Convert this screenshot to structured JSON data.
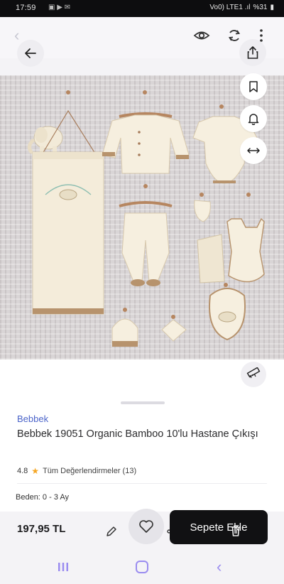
{
  "status_bar": {
    "time": "17:59",
    "signal_text": "Vo0) LTE1 .ıl",
    "battery": "%31"
  },
  "product": {
    "brand": "Bebbek",
    "title": "Bebbek 19051 Organic Bamboo 10'lu Hastane Çıkışı",
    "rating": "4.8",
    "reviews_label": "Tüm Değerlendirmeler (13)",
    "size_label": "Beden: 0 - 3 Ay",
    "price": "197,95 TL"
  },
  "actions": {
    "add_to_cart": "Sepete Ekle"
  },
  "colors": {
    "brand": "#4a63c9",
    "star": "#f5a623",
    "cta_bg": "#111113",
    "nav_accent": "#9a8cf0"
  },
  "icons": [
    "back-arrow-icon",
    "eye-icon",
    "rotate-icon",
    "more-vertical-icon",
    "share-icon",
    "bookmark-icon",
    "bell-icon",
    "compare-icon",
    "ruler-icon",
    "edit-icon",
    "heart-icon",
    "trash-icon"
  ]
}
